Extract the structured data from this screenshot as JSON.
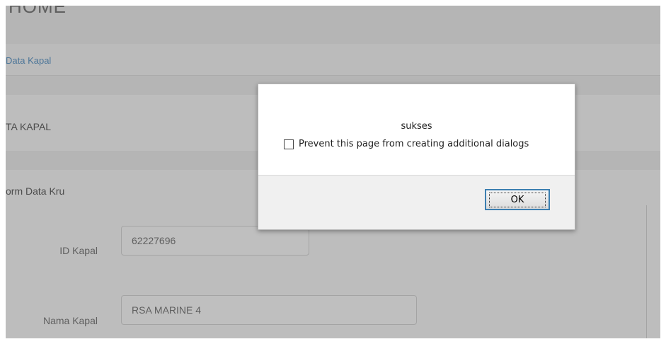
{
  "page": {
    "title": "HOME",
    "breadcrumb": "Data Kapal",
    "panel_title": "TA KAPAL",
    "form_title": "orm Data Kru",
    "fields": [
      {
        "label": "ID Kapal",
        "value": "62227696"
      },
      {
        "label": "Nama Kapal",
        "value": "RSA MARINE 4"
      }
    ]
  },
  "dialog": {
    "message": "sukses",
    "prevent_label": "Prevent this page from creating additional dialogs",
    "ok_label": "OK"
  }
}
